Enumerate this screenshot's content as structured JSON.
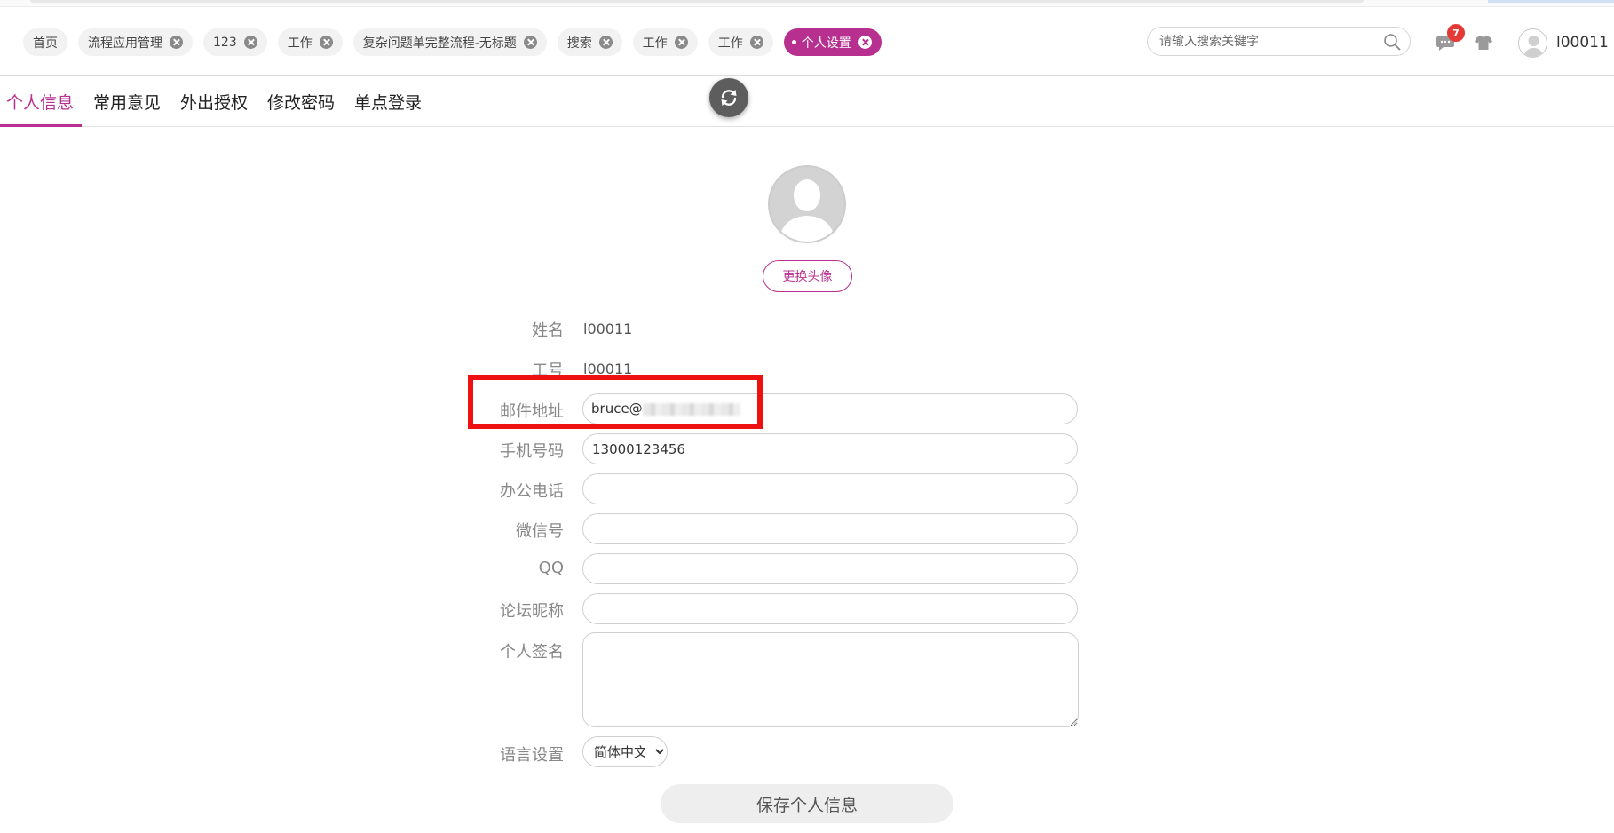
{
  "tabs": [
    {
      "label": "首页",
      "closable": false
    },
    {
      "label": "流程应用管理",
      "closable": true
    },
    {
      "label": "123",
      "closable": true
    },
    {
      "label": "工作",
      "closable": true
    },
    {
      "label": "复杂问题单完整流程-无标题",
      "closable": true
    },
    {
      "label": "搜索",
      "closable": true
    },
    {
      "label": "工作",
      "closable": true
    },
    {
      "label": "工作",
      "closable": true
    },
    {
      "label": "个人设置",
      "closable": true,
      "active": true
    }
  ],
  "search": {
    "placeholder": "请输入搜索关键字"
  },
  "notifications": {
    "count": "7"
  },
  "user": {
    "name": "l00011"
  },
  "subnav": {
    "items": [
      "个人信息",
      "常用意见",
      "外出授权",
      "修改密码",
      "单点登录"
    ]
  },
  "profile": {
    "change_avatar_label": "更换头像",
    "name_label": "姓名",
    "name_value": "l00011",
    "empno_label": "工号",
    "empno_value": "l00011",
    "email_label": "邮件地址",
    "email_value": "bruce@",
    "phone_label": "手机号码",
    "phone_value": "13000123456",
    "office_label": "办公电话",
    "office_value": "",
    "wechat_label": "微信号",
    "wechat_value": "",
    "qq_label": "QQ",
    "qq_value": "",
    "forum_label": "论坛昵称",
    "forum_value": "",
    "signature_label": "个人签名",
    "signature_value": "",
    "language_label": "语言设置",
    "language_selected": "简体中文",
    "save_label": "保存个人信息"
  },
  "colors": {
    "accent": "#b8308f",
    "highlight": "#ee1111",
    "badge": "#e53935"
  }
}
